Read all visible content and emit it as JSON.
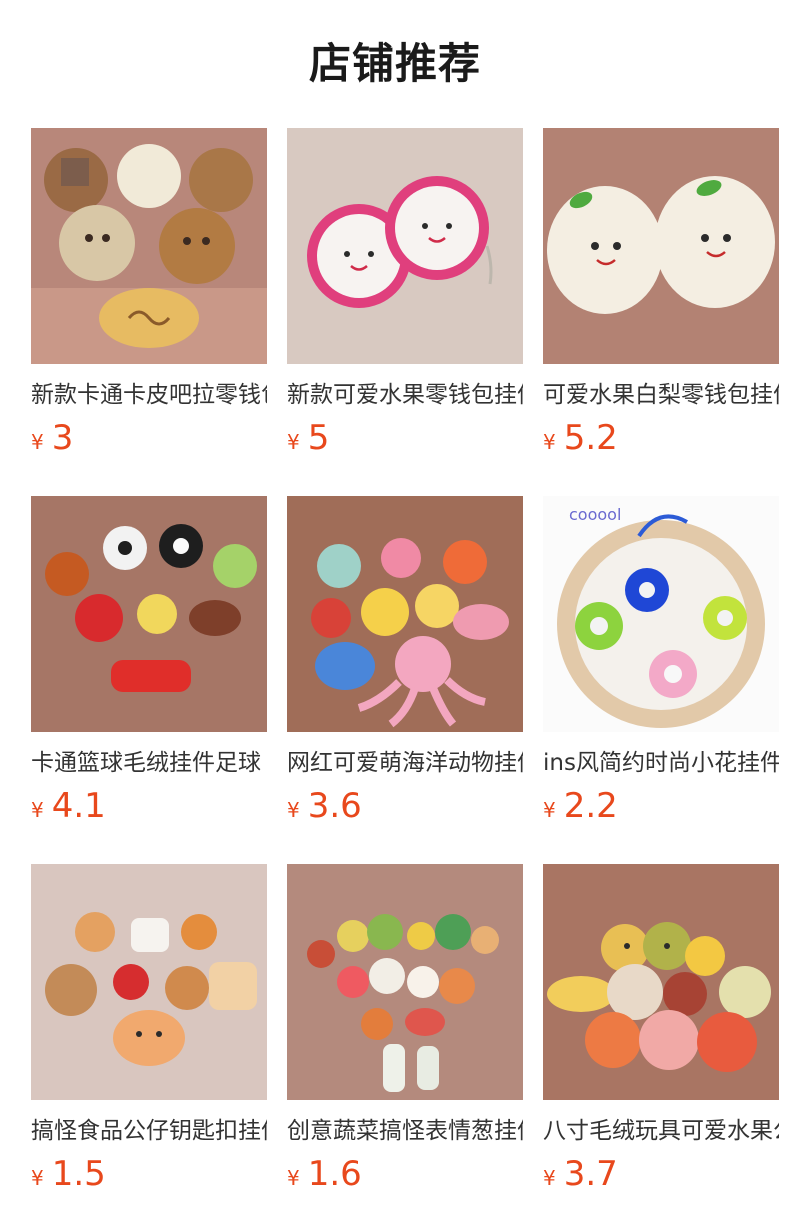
{
  "page_title": "店铺推荐",
  "currency_symbol": "¥",
  "colors": {
    "price": "#e8481c",
    "title": "#1a1a1a",
    "name": "#333333"
  },
  "products": [
    {
      "name": "新款卡通卡皮吧拉零钱包",
      "price": "3",
      "image": "capybara-plush-purses"
    },
    {
      "name": "新款可爱水果零钱包挂件",
      "price": "5",
      "image": "dragon-fruit-plush-purses"
    },
    {
      "name": "可爱水果白梨零钱包挂件",
      "price": "5.2",
      "image": "white-pear-plush-purses"
    },
    {
      "name": "卡通篮球毛绒挂件足球",
      "price": "4.1",
      "image": "sports-ball-plush-keychains"
    },
    {
      "name": "网红可爱萌海洋动物挂件",
      "price": "3.6",
      "image": "sea-animal-plush-keychains"
    },
    {
      "name": "ins风简约时尚小花挂件",
      "price": "2.2",
      "image": "flower-plush-keychains"
    },
    {
      "name": "搞怪食品公仔钥匙扣挂件",
      "price": "1.5",
      "image": "food-plush-keychains"
    },
    {
      "name": "创意蔬菜搞怪表情葱挂件",
      "price": "1.6",
      "image": "vegetable-plush-keychains"
    },
    {
      "name": "八寸毛绒玩具可爱水果公仔",
      "price": "3.7",
      "image": "fruit-plush-toys"
    }
  ]
}
